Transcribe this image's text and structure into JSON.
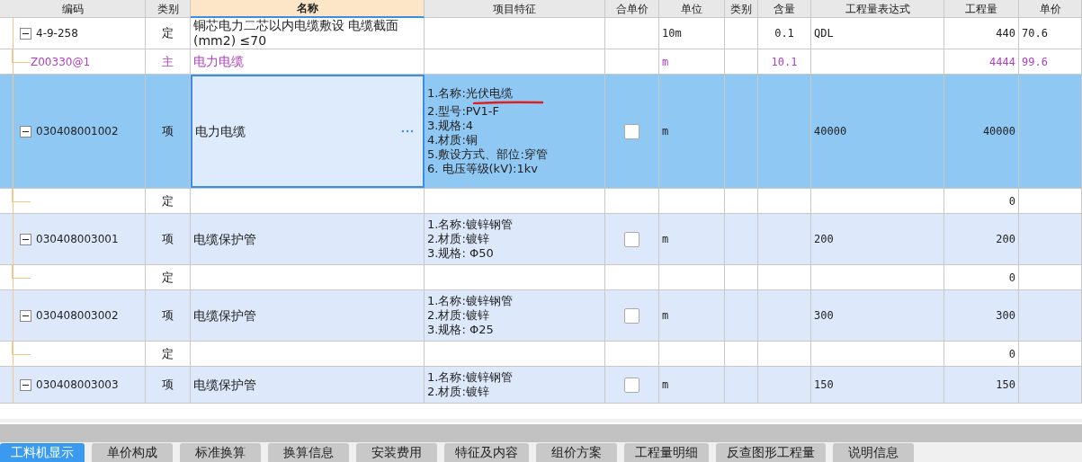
{
  "table": {
    "columns": [
      {
        "label": "编码",
        "selected": false
      },
      {
        "label": "类别",
        "selected": false
      },
      {
        "label": "名称",
        "selected": true
      },
      {
        "label": "项目特征",
        "selected": false
      },
      {
        "label": "合单价",
        "selected": false
      },
      {
        "label": "单位",
        "selected": false
      },
      {
        "label": "类别",
        "selected": false
      },
      {
        "label": "含量",
        "selected": false
      },
      {
        "label": "工程量表达式",
        "selected": false
      },
      {
        "label": "工程量",
        "selected": false
      },
      {
        "label": "单价",
        "selected": false
      }
    ],
    "rows": [
      {
        "kind": "quota",
        "code": "4-9-258",
        "type": "定",
        "name": "铜芯电力二芯以内电缆敷设 电缆截面(mm2) ≤70",
        "unit": "10m",
        "content": "0.1",
        "expression": "QDL",
        "quantity": "440",
        "price": "70.6",
        "selected": false,
        "expanded": true,
        "children": [
          {
            "kind": "material",
            "code": "Z00330@1",
            "type": "主",
            "name": "电力电缆",
            "unit": "m",
            "content": "10.1",
            "quantity": "4444",
            "price": "99.6",
            "selected": false
          }
        ]
      },
      {
        "kind": "item",
        "code": "030408001002",
        "type": "项",
        "name": "电力电缆",
        "features": [
          "1.名称:光伏电缆",
          "2.型号:PV1-F",
          "3.规格:4",
          "4.材质:铜",
          "5.敷设方式、部位:穿管",
          "6. 电压等级(kV):1kv"
        ],
        "checked": false,
        "unit": "m",
        "expression": "40000",
        "quantity": "40000",
        "selected": true,
        "expanded": true,
        "children": [
          {
            "kind": "quota",
            "type": "定",
            "quantity": "0",
            "selected": false
          }
        ]
      },
      {
        "kind": "item",
        "code": "030408003001",
        "type": "项",
        "name": "电缆保护管",
        "features": [
          "1.名称:镀锌钢管",
          "2.材质:镀锌",
          "3.规格: Φ50"
        ],
        "checked": false,
        "unit": "m",
        "expression": "200",
        "quantity": "200",
        "selected": false,
        "expanded": true,
        "children": [
          {
            "kind": "quota",
            "type": "定",
            "quantity": "0",
            "selected": false
          }
        ]
      },
      {
        "kind": "item",
        "code": "030408003002",
        "type": "项",
        "name": "电缆保护管",
        "features": [
          "1.名称:镀锌钢管",
          "2.材质:镀锌",
          "3.规格: Φ25"
        ],
        "checked": false,
        "unit": "m",
        "expression": "300",
        "quantity": "300",
        "selected": false,
        "expanded": true,
        "children": [
          {
            "kind": "quota",
            "type": "定",
            "quantity": "0",
            "selected": false
          }
        ]
      },
      {
        "kind": "item",
        "code": "030408003003",
        "type": "项",
        "name": "电缆保护管",
        "features": [
          "1.名称:镀锌钢管",
          "2.材质:镀锌"
        ],
        "checked": false,
        "unit": "m",
        "expression": "150",
        "quantity": "150",
        "selected": false,
        "expanded": true
      }
    ]
  },
  "tabs": [
    {
      "label": "工料机显示",
      "selected": true
    },
    {
      "label": "单价构成",
      "selected": false
    },
    {
      "label": "标准换算",
      "selected": false
    },
    {
      "label": "换算信息",
      "selected": false
    },
    {
      "label": "安装费用",
      "selected": false
    },
    {
      "label": "特征及内容",
      "selected": false
    },
    {
      "label": "组价方案",
      "selected": false
    },
    {
      "label": "工程量明细",
      "selected": false
    },
    {
      "label": "反查图形工程量",
      "selected": false
    },
    {
      "label": "说明信息",
      "selected": false
    }
  ]
}
